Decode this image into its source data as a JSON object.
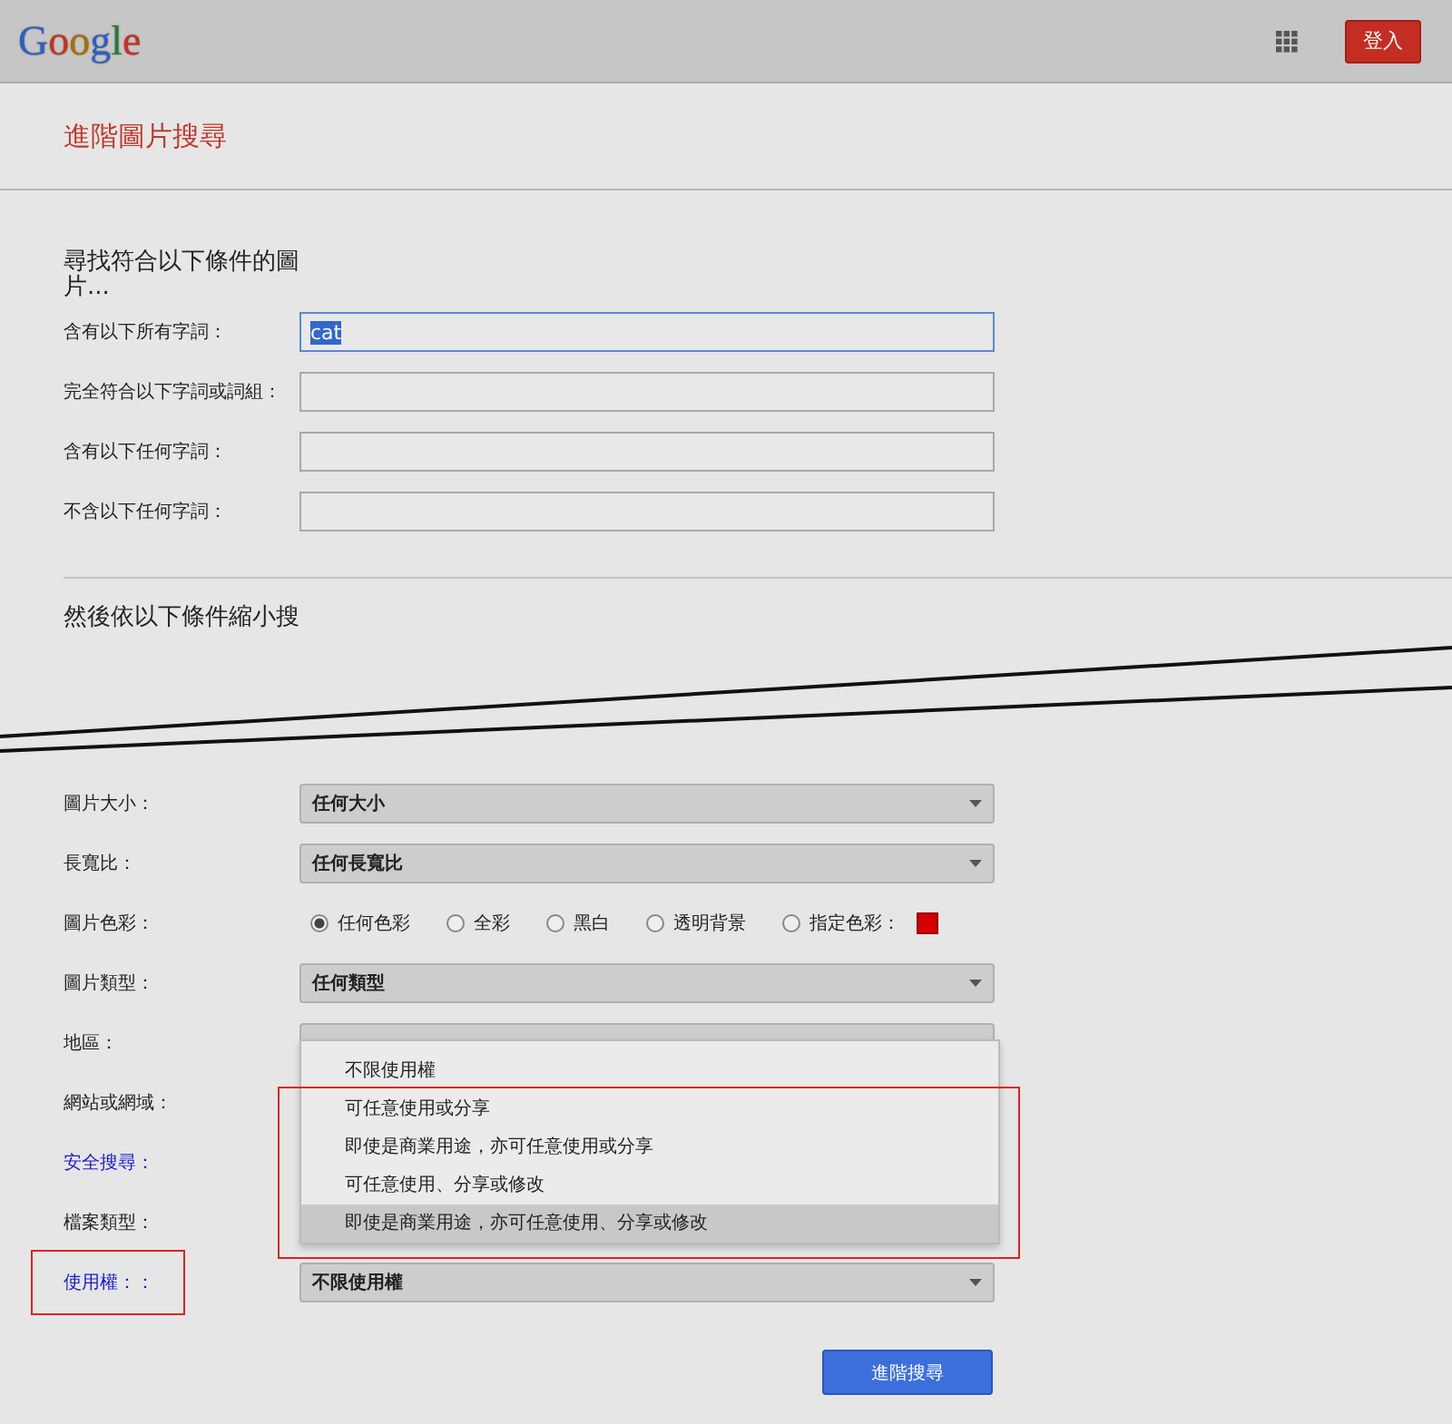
{
  "header": {
    "logo": "Google",
    "sign_in": "登入"
  },
  "page_title": "進階圖片搜尋",
  "find_section": {
    "heading": "尋找符合以下條件的圖片...",
    "fields": [
      {
        "label": "含有以下所有字詞：",
        "value": "cat",
        "focused": true
      },
      {
        "label": "完全符合以下字詞或詞組：",
        "focused": false
      },
      {
        "label": "含有以下任何字詞：",
        "focused": false
      },
      {
        "label": "不含以下任何字詞：",
        "focused": false
      }
    ]
  },
  "narrow_section": {
    "heading": "然後依以下條件縮小搜",
    "rows": [
      {
        "kind": "select",
        "label": "圖片大小：",
        "link": false,
        "value": "任何大小"
      },
      {
        "kind": "select",
        "label": "長寬比：",
        "link": false,
        "value": "任何長寬比"
      },
      {
        "kind": "radio",
        "label": "圖片色彩：",
        "link": false,
        "options": [
          {
            "label": "任何色彩",
            "selected": true
          },
          {
            "label": "全彩",
            "selected": false
          },
          {
            "label": "黑白",
            "selected": false
          },
          {
            "label": "透明背景",
            "selected": false
          },
          {
            "label": "指定色彩：",
            "selected": false,
            "color": "#d40000"
          }
        ]
      },
      {
        "kind": "select",
        "label": "圖片類型：",
        "link": false,
        "value": "任何類型"
      },
      {
        "kind": "select",
        "label": "地區：",
        "link": false,
        "dropdown": [
          {
            "label": "不限使用權",
            "highlighted": false
          },
          {
            "label": "可任意使用或分享",
            "highlighted": false
          },
          {
            "label": "即使是商業用途，亦可任意使用或分享",
            "highlighted": false
          },
          {
            "label": "可任意使用、分享或修改",
            "highlighted": false
          },
          {
            "label": "即使是商業用途，亦可任意使用、分享或修改",
            "highlighted": true
          }
        ]
      },
      {
        "kind": "plain",
        "label": "網站或網域：",
        "link": false
      },
      {
        "kind": "plain",
        "label": "安全搜尋：",
        "link": true
      },
      {
        "kind": "plain",
        "label": "檔案類型：",
        "link": false
      },
      {
        "kind": "select",
        "label": "使用權：：",
        "link": true,
        "value": "不限使用權",
        "framed": true
      }
    ]
  },
  "submit": "進階搜尋"
}
